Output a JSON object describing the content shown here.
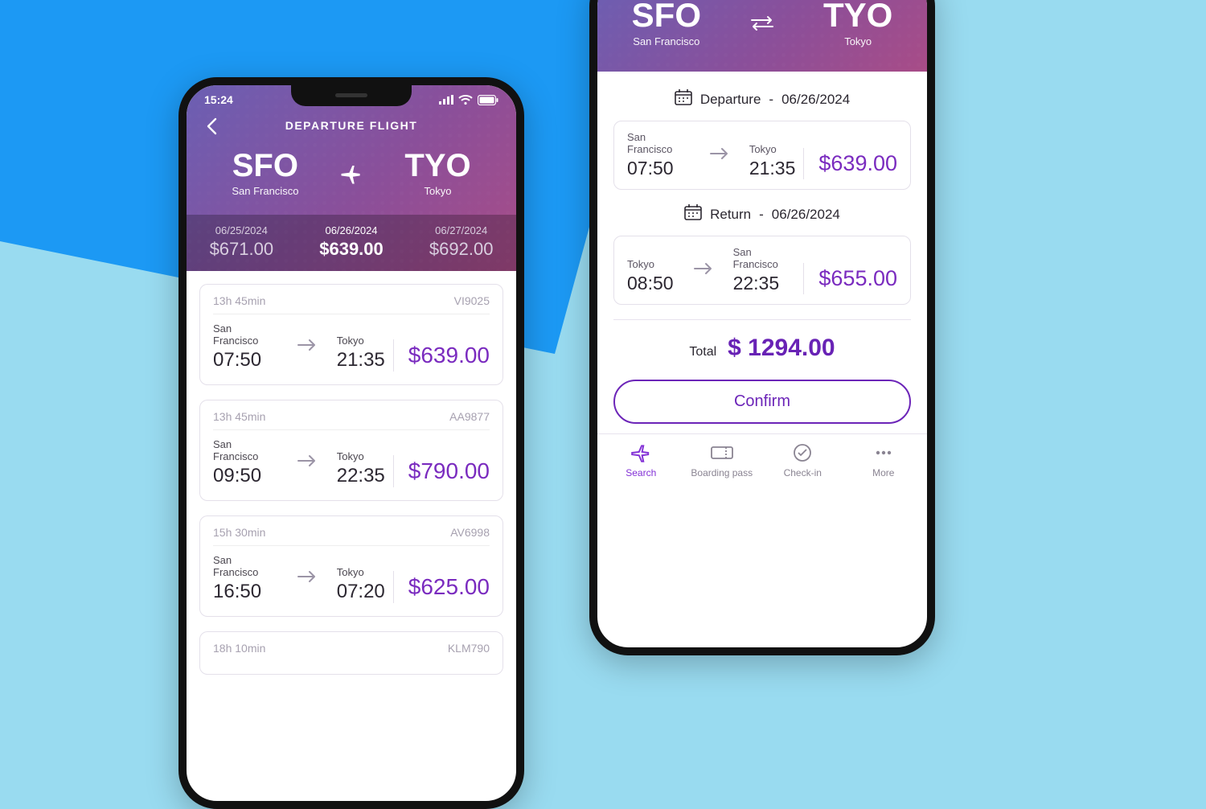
{
  "statusbar": {
    "time": "15:24"
  },
  "screen1": {
    "title": "DEPARTURE FLIGHT",
    "from_code": "SFO",
    "from_city": "San Francisco",
    "to_code": "TYO",
    "to_city": "Tokyo",
    "dates": [
      {
        "date": "06/25/2024",
        "price": "$671.00",
        "selected": false
      },
      {
        "date": "06/26/2024",
        "price": "$639.00",
        "selected": true
      },
      {
        "date": "06/27/2024",
        "price": "$692.00",
        "selected": false
      }
    ],
    "flights": [
      {
        "duration": "13h 45min",
        "code": "VI9025",
        "from": "San Francisco",
        "to": "Tokyo",
        "dep": "07:50",
        "arr": "21:35",
        "price": "$639.00"
      },
      {
        "duration": "13h 45min",
        "code": "AA9877",
        "from": "San Francisco",
        "to": "Tokyo",
        "dep": "09:50",
        "arr": "22:35",
        "price": "$790.00"
      },
      {
        "duration": "15h 30min",
        "code": "AV6998",
        "from": "San Francisco",
        "to": "Tokyo",
        "dep": "16:50",
        "arr": "07:20",
        "price": "$625.00"
      },
      {
        "duration": "18h 10min",
        "code": "KLM790",
        "from": "",
        "to": "",
        "dep": "",
        "arr": "",
        "price": ""
      }
    ]
  },
  "screen2": {
    "from_code": "SFO",
    "from_city": "San Francisco",
    "to_code": "TYO",
    "to_city": "Tokyo",
    "departure_label": "Departure",
    "return_label": "Return",
    "separator": "-",
    "departure_date": "06/26/2024",
    "return_date": "06/26/2024",
    "dep_flight": {
      "from": "San Francisco",
      "to": "Tokyo",
      "dep": "07:50",
      "arr": "21:35",
      "price": "$639.00"
    },
    "ret_flight": {
      "from": "Tokyo",
      "to": "San Francisco",
      "dep": "08:50",
      "arr": "22:35",
      "price": "$655.00"
    },
    "total_label": "Total",
    "total_amount": "$ 1294.00",
    "confirm_label": "Confirm",
    "tabs": [
      {
        "label": "Search",
        "active": true
      },
      {
        "label": "Boarding pass",
        "active": false
      },
      {
        "label": "Check-in",
        "active": false
      },
      {
        "label": "More",
        "active": false
      }
    ]
  }
}
